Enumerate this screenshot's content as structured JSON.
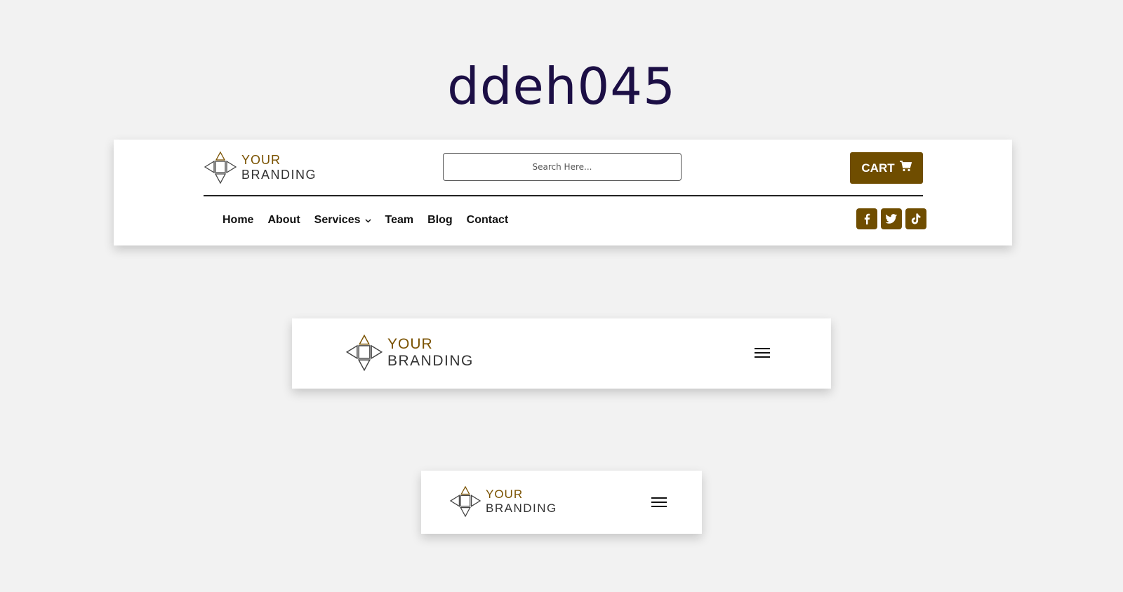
{
  "page": {
    "title": "ddeh045"
  },
  "logo": {
    "line1": "YOUR",
    "line2": "BRANDING"
  },
  "header1": {
    "search_placeholder": "Search Here...",
    "cart_label": "CART",
    "nav": [
      {
        "label": "Home"
      },
      {
        "label": "About"
      },
      {
        "label": "Services",
        "has_dropdown": true
      },
      {
        "label": "Team"
      },
      {
        "label": "Blog"
      },
      {
        "label": "Contact"
      }
    ],
    "socials": [
      "facebook-icon",
      "twitter-icon",
      "tiktok-icon"
    ]
  },
  "header2": {
    "menu_icon": "hamburger-icon"
  },
  "header3": {
    "menu_icon": "hamburger-icon"
  },
  "colors": {
    "accent": "#6f4d00",
    "logo_gold": "#7a5200",
    "title": "#1c0f45",
    "background": "#f2f2f2"
  }
}
